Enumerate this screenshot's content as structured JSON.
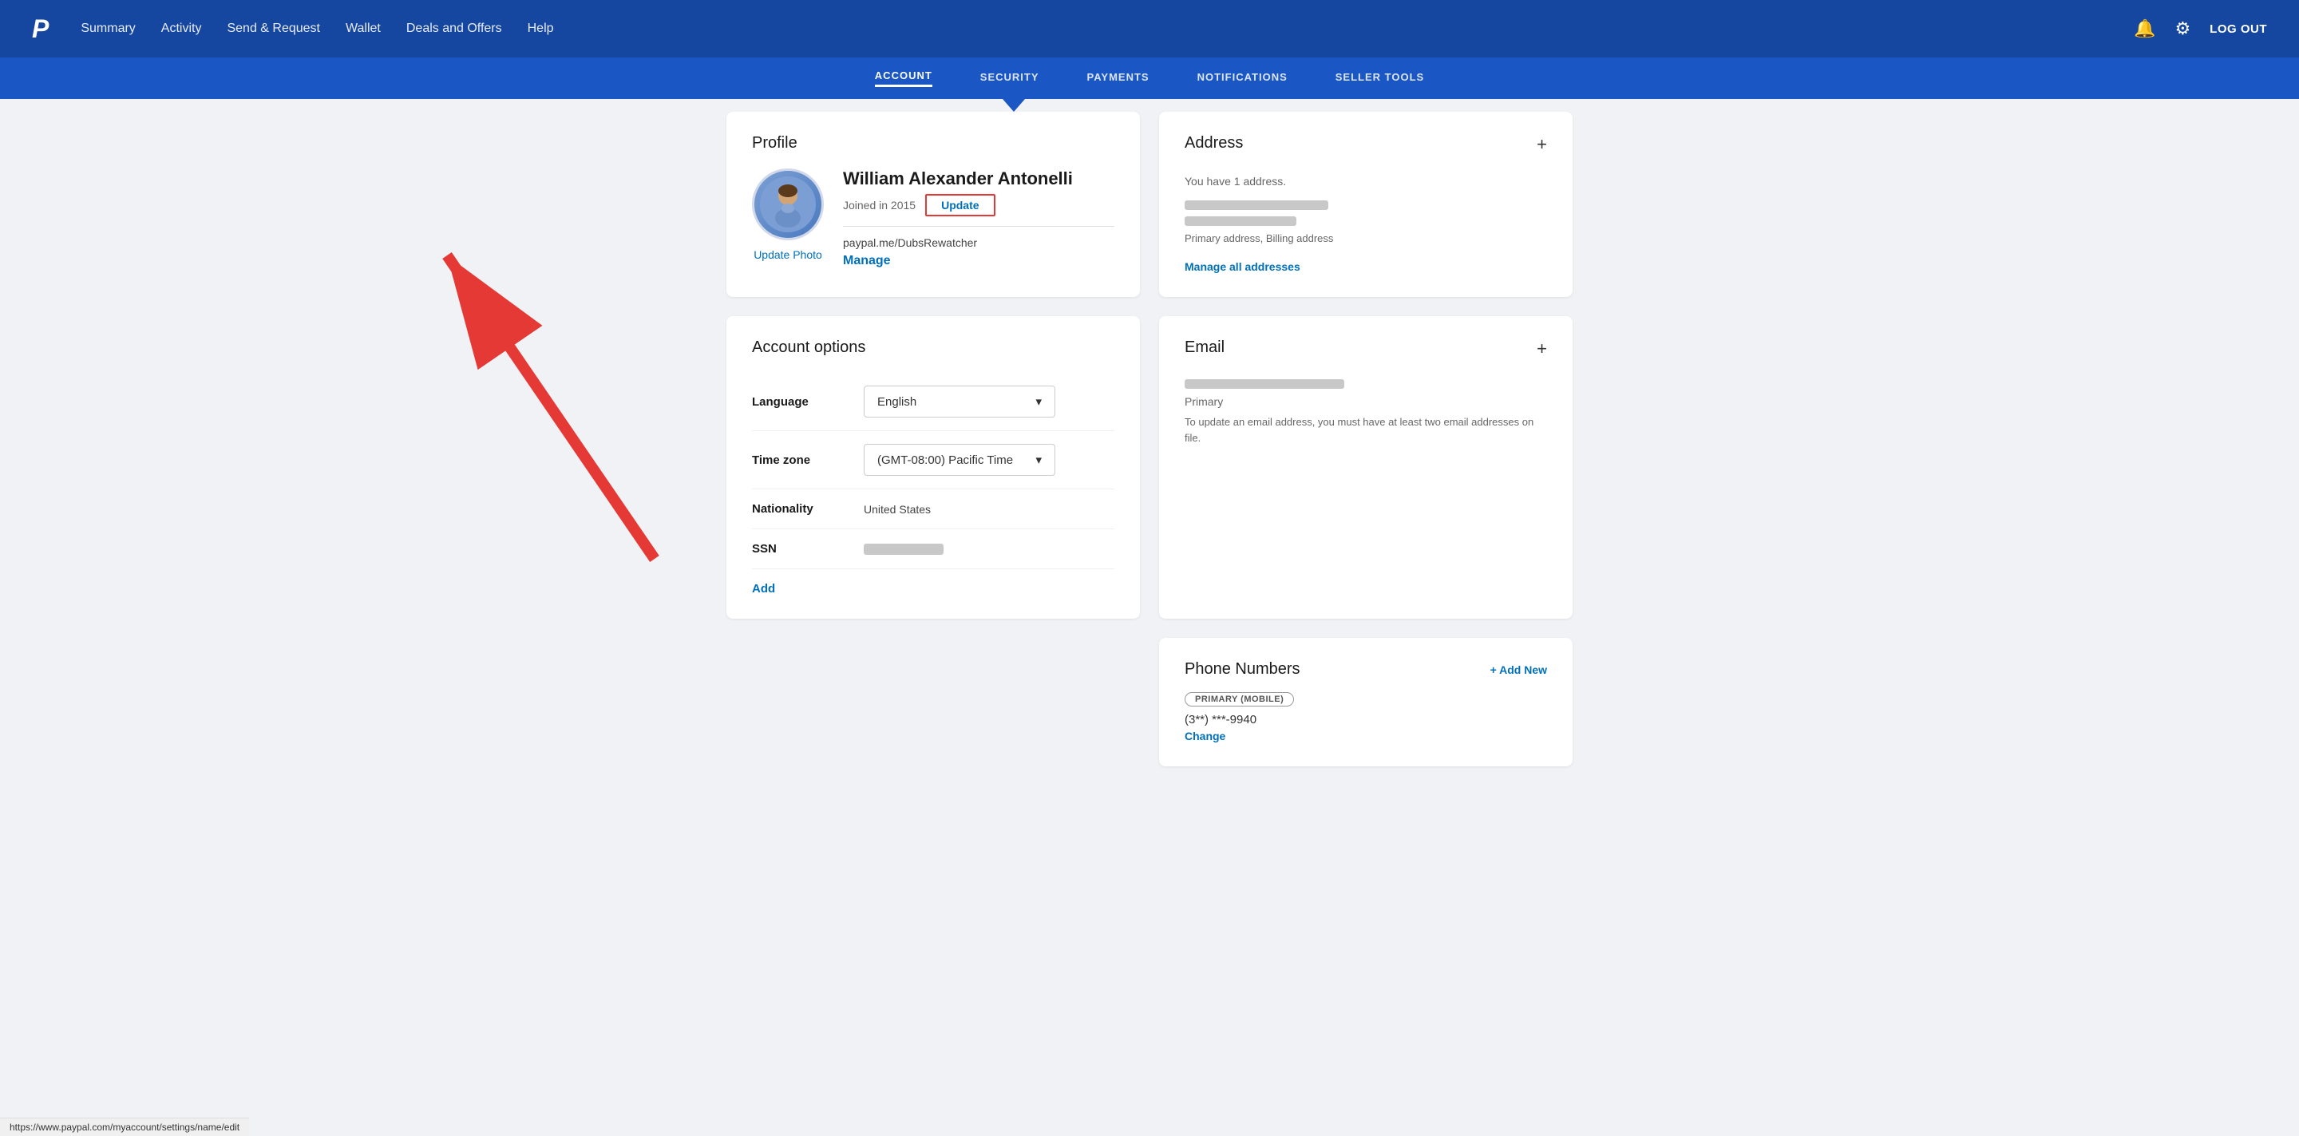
{
  "topNav": {
    "logo": "P",
    "links": [
      {
        "label": "Summary",
        "href": "#"
      },
      {
        "label": "Activity",
        "href": "#"
      },
      {
        "label": "Send & Request",
        "href": "#"
      },
      {
        "label": "Wallet",
        "href": "#"
      },
      {
        "label": "Deals and Offers",
        "href": "#"
      },
      {
        "label": "Help",
        "href": "#"
      }
    ],
    "logoutLabel": "LOG OUT"
  },
  "subNav": {
    "links": [
      {
        "label": "ACCOUNT",
        "active": true
      },
      {
        "label": "SECURITY",
        "active": false
      },
      {
        "label": "PAYMENTS",
        "active": false
      },
      {
        "label": "NOTIFICATIONS",
        "active": false
      },
      {
        "label": "SELLER TOOLS",
        "active": false
      }
    ]
  },
  "profile": {
    "title": "Profile",
    "name": "William Alexander Antonelli",
    "joinedText": "Joined in 2015",
    "updateLabel": "Update",
    "paypalMe": "paypal.me/DubsRewatcher",
    "manageLabel": "Manage",
    "updatePhotoLabel": "Update Photo"
  },
  "accountOptions": {
    "title": "Account options",
    "rows": [
      {
        "label": "Language",
        "type": "select",
        "value": "English"
      },
      {
        "label": "Time zone",
        "type": "select",
        "value": "(GMT-08:00) Pacific Time"
      },
      {
        "label": "Nationality",
        "type": "text",
        "value": "United States"
      },
      {
        "label": "SSN",
        "type": "blur",
        "value": ""
      }
    ],
    "addLabel": "Add"
  },
  "address": {
    "title": "Address",
    "subtitle": "You have 1 address.",
    "type": "Primary address, Billing address",
    "manageAllLabel": "Manage all addresses"
  },
  "email": {
    "title": "Email",
    "primaryLabel": "Primary",
    "note": "To update an email address, you must have at least two email addresses on file."
  },
  "phone": {
    "title": "Phone Numbers",
    "addNewLabel": "+ Add New",
    "badge": "PRIMARY (MOBILE)",
    "number": "(3**) ***-9940",
    "changeLabel": "Change"
  },
  "statusBar": {
    "url": "https://www.paypal.com/myaccount/settings/name/edit"
  }
}
